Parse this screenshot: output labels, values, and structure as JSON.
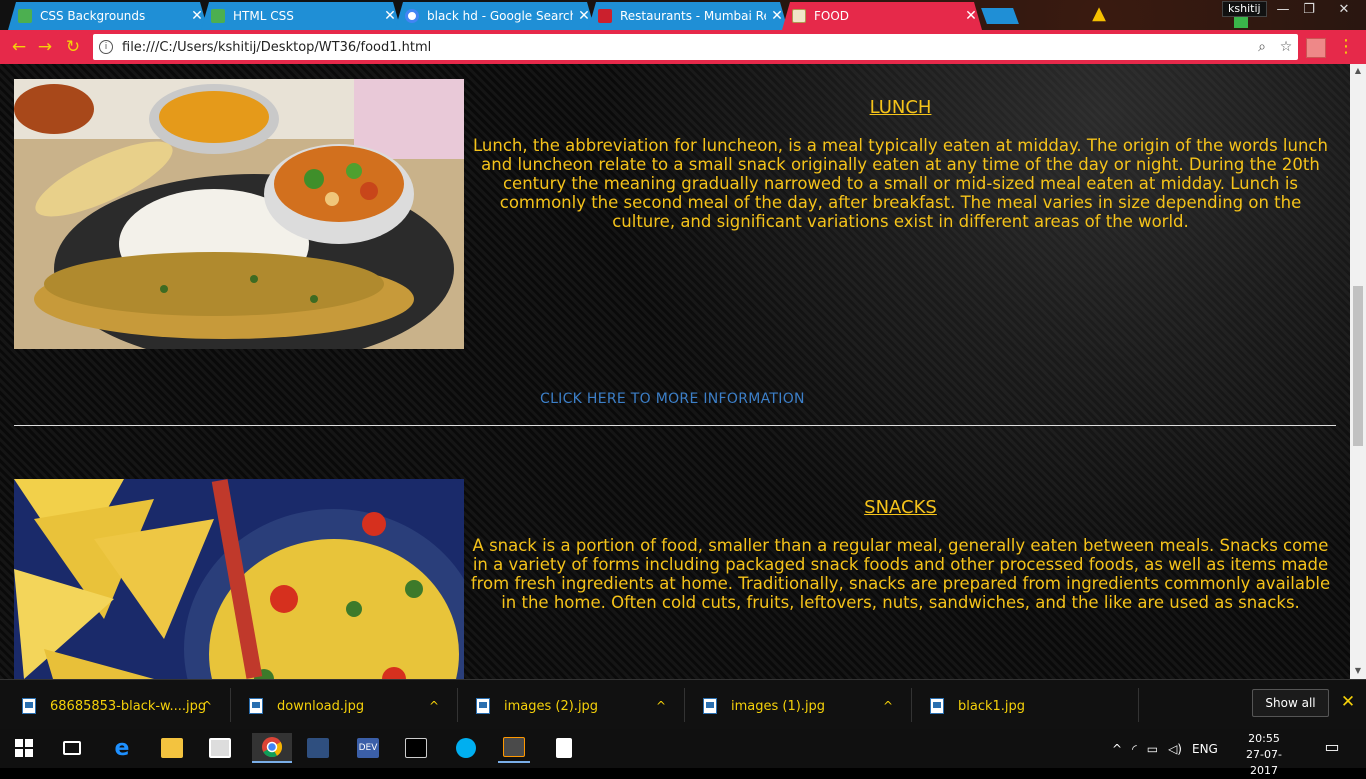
{
  "browser": {
    "tabs": [
      {
        "title": "CSS Backgrounds",
        "icon": "w3schools-icon",
        "active": false
      },
      {
        "title": "HTML CSS",
        "icon": "w3schools-icon",
        "active": false
      },
      {
        "title": "black hd - Google Search",
        "icon": "google-icon",
        "active": false
      },
      {
        "title": "Restaurants - Mumbai Restaurants",
        "icon": "zomato-icon",
        "active": false
      },
      {
        "title": "FOOD",
        "icon": "file-icon",
        "active": true
      }
    ],
    "close_glyph": "✕",
    "user": "kshitij",
    "url": "file:///C:/Users/kshitij/Desktop/WT36/food1.html",
    "accent": "#e6294a",
    "tab_color": "#1f8fd6"
  },
  "page": {
    "sections": [
      {
        "heading": "LUNCH",
        "text": "Lunch, the abbreviation for luncheon, is a meal typically eaten at midday. The origin of the words lunch and luncheon relate to a small snack originally eaten at any time of the day or night. During the 20th century the meaning gradually narrowed to a small or mid-sized meal eaten at midday. Lunch is commonly the second meal of the day, after breakfast. The meal varies in size depending on the culture, and significant variations exist in different areas of the world.",
        "image": "lunch-thali-image"
      },
      {
        "heading": "SNACKS",
        "text": "A snack is a portion of food, smaller than a regular meal, generally eaten between meals. Snacks come in a variety of forms including packaged snack foods and other processed foods, as well as items made from fresh ingredients at home. Traditionally, snacks are prepared from ingredients commonly available in the home. Often cold cuts, fruits, leftovers, nuts, sandwiches, and the like are used as snacks.",
        "image": "snacks-nachos-corn-image"
      }
    ],
    "more_link": "CLICK HERE TO MORE INFORMATION",
    "text_color": "#f5c31a",
    "link_color": "#3c7fc8"
  },
  "downloads": {
    "items": [
      "68685853-black-w....jpg",
      "download.jpg",
      "images (2).jpg",
      "images (1).jpg",
      "black1.jpg"
    ],
    "show_all": "Show all"
  },
  "taskbar": {
    "language": "ENG",
    "time": "20:55",
    "date": "27-07-2017"
  }
}
